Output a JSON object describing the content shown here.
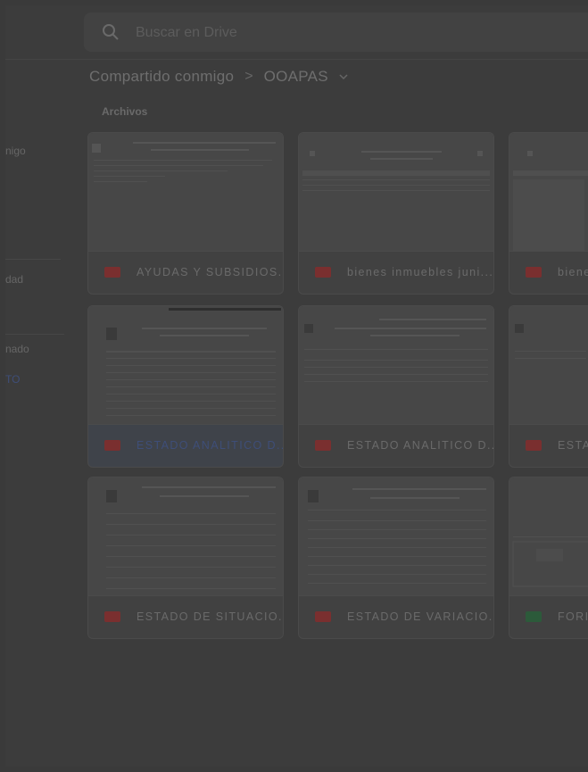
{
  "search": {
    "placeholder": "Buscar en Drive"
  },
  "breadcrumb": {
    "parent": "Compartido conmigo",
    "separator": ">",
    "current": "OOAPAS"
  },
  "section": {
    "files_label": "Archivos"
  },
  "sidebar": {
    "items": [
      {
        "label": "nigo"
      },
      {
        "label": "dad"
      },
      {
        "label": "nado"
      },
      {
        "label": "TO"
      }
    ]
  },
  "files": [
    {
      "name": "AYUDAS Y SUBSIDIOS...",
      "type": "pdf",
      "selected": false
    },
    {
      "name": "bienes inmuebles juni...",
      "type": "pdf",
      "selected": false
    },
    {
      "name": "biene",
      "type": "pdf",
      "selected": false
    },
    {
      "name": "ESTADO ANALITICO D...",
      "type": "pdf",
      "selected": true
    },
    {
      "name": "ESTADO ANALITICO D...",
      "type": "pdf",
      "selected": false
    },
    {
      "name": "ESTA",
      "type": "pdf",
      "selected": false
    },
    {
      "name": "ESTADO DE SITUACIO...",
      "type": "pdf",
      "selected": false
    },
    {
      "name": "ESTADO DE VARIACIO...",
      "type": "pdf",
      "selected": false
    },
    {
      "name": "FORI",
      "type": "xls",
      "selected": false
    }
  ],
  "colors": {
    "pdf_badge": "#7a2f2f",
    "xls_badge": "#2c5a3a",
    "selected_text": "#3e4e78"
  }
}
